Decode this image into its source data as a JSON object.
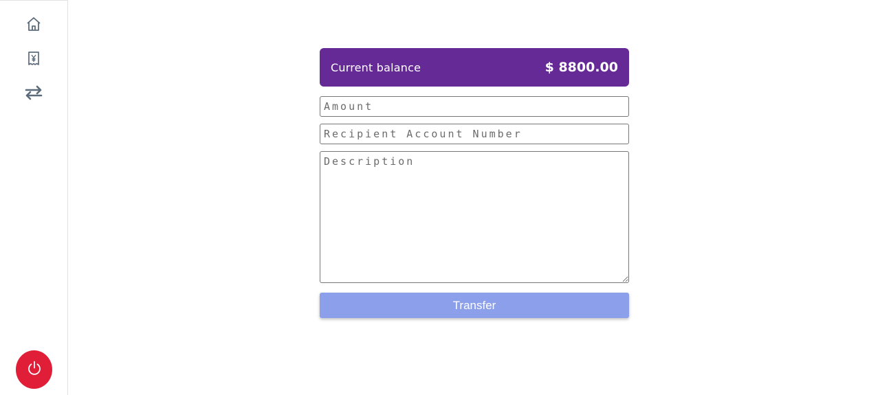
{
  "sidebar": {
    "items": [
      {
        "icon": "home-icon"
      },
      {
        "icon": "yen-receipt-icon"
      },
      {
        "icon": "transfer-arrows-icon"
      }
    ],
    "logout_icon": "power-icon"
  },
  "balance": {
    "label": "Current balance",
    "value": "$ 8800.00"
  },
  "form": {
    "amount_placeholder": "Amount",
    "recipient_placeholder": "Recipient Account Number",
    "description_placeholder": "Description",
    "submit_label": "Transfer"
  },
  "colors": {
    "balance_card": "#662a96",
    "transfer_button": "#8c9fea",
    "logout_button": "#e01e37",
    "icon": "#5c6b7a"
  }
}
